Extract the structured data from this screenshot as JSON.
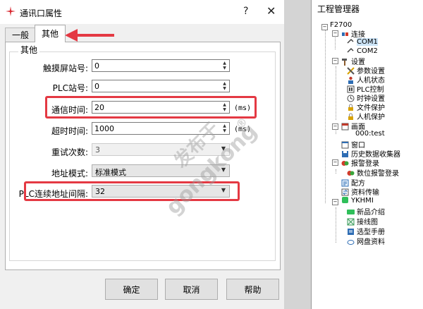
{
  "dialog": {
    "title": "通讯口属性",
    "help_glyph": "?",
    "close_glyph": "✕",
    "tabs": [
      {
        "label": "一般"
      },
      {
        "label": "其他"
      }
    ],
    "group_title": "其他",
    "fields": {
      "touch_station": {
        "label": "触摸屏站号:",
        "value": "0"
      },
      "plc_station": {
        "label": "PLC站号:",
        "value": "0"
      },
      "comm_time": {
        "label": "通信时间:",
        "value": "20",
        "unit": "(ms)"
      },
      "timeout": {
        "label": "超时时间:",
        "value": "1000",
        "unit": "(ms)"
      },
      "retry": {
        "label": "重试次数:",
        "value": "3"
      },
      "address_mode": {
        "label": "地址模式:",
        "value": "标准模式"
      },
      "plc_interval": {
        "label": "PLC连续地址间隔:",
        "value": "32"
      }
    },
    "buttons": {
      "ok": "确定",
      "cancel": "取消",
      "help": "帮助"
    }
  },
  "watermark": {
    "line1": "发布于",
    "line2": "gongkong",
    "mark": "®"
  },
  "project_manager": {
    "title": "工程管理器",
    "tree": {
      "root": "F2700",
      "connect": "连接",
      "com1": "COM1",
      "com2": "COM2",
      "settings": "设置",
      "params": "参数设置",
      "hmi_status": "人机状态",
      "plc_control": "PLC控制",
      "clock": "时钟设置",
      "file_protect": "文件保护",
      "hmi_protect": "人机保护",
      "screens": "画面",
      "screen0": "000:test",
      "window": "窗口",
      "history": "历史数据收集器",
      "alarm": "报警登录",
      "digital_alarm": "数位报警登录",
      "recipe": "配方",
      "transfer": "资料传输",
      "ykhmi": "YKHMI",
      "new_product": "新品介绍",
      "wiring": "接线图",
      "manual": "选型手册",
      "netdisk": "网盘资料"
    }
  },
  "colors": {
    "highlight": "#e43943",
    "selection": "#cce4f7"
  }
}
